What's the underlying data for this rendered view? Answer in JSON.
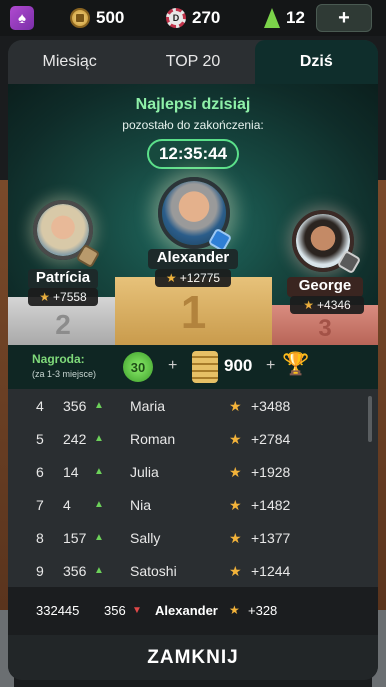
{
  "topbar": {
    "coins": "500",
    "chips": "270",
    "chip_letter": "D",
    "gems": "12",
    "add_label": "+"
  },
  "tabs": [
    {
      "label": "Miesiąc"
    },
    {
      "label": "TOP 20"
    },
    {
      "label": "Dziś",
      "active": true
    }
  ],
  "stage": {
    "heading": "Najlepsi dzisiaj",
    "subheading": "pozostało do zakończenia:",
    "timer": "12:35:44"
  },
  "podium": [
    {
      "place": "1",
      "name": "Alexander",
      "score": "+12775"
    },
    {
      "place": "2",
      "name": "Patrícia",
      "score": "+7558"
    },
    {
      "place": "3",
      "name": "George",
      "score": "+4346"
    }
  ],
  "reward": {
    "label": "Nagroda:",
    "sublabel": "(za 1-3 miejsce)",
    "xp": "30",
    "plus": "+",
    "gold": "900"
  },
  "rows": [
    {
      "rank": "4",
      "level": "356",
      "name": "Maria",
      "score": "+3488"
    },
    {
      "rank": "5",
      "level": "242",
      "name": "Roman",
      "score": "+2784"
    },
    {
      "rank": "6",
      "level": "14",
      "name": "Julia",
      "score": "+1928"
    },
    {
      "rank": "7",
      "level": "4",
      "name": "Nia",
      "score": "+1482"
    },
    {
      "rank": "8",
      "level": "157",
      "name": "Sally",
      "score": "+1377"
    },
    {
      "rank": "9",
      "level": "356",
      "name": "Satoshi",
      "score": "+1244"
    }
  ],
  "self": {
    "rank": "332445",
    "level": "356",
    "name": "Alexander",
    "score": "+328"
  },
  "close_label": "ZAMKNIJ",
  "colors": {
    "accent_green": "#8ef0a8",
    "star": "#f3b33a",
    "trend_up": "#6cd15a",
    "trend_down": "#e04848"
  },
  "icons": {
    "up": "▲",
    "down": "▼",
    "star": "★"
  }
}
